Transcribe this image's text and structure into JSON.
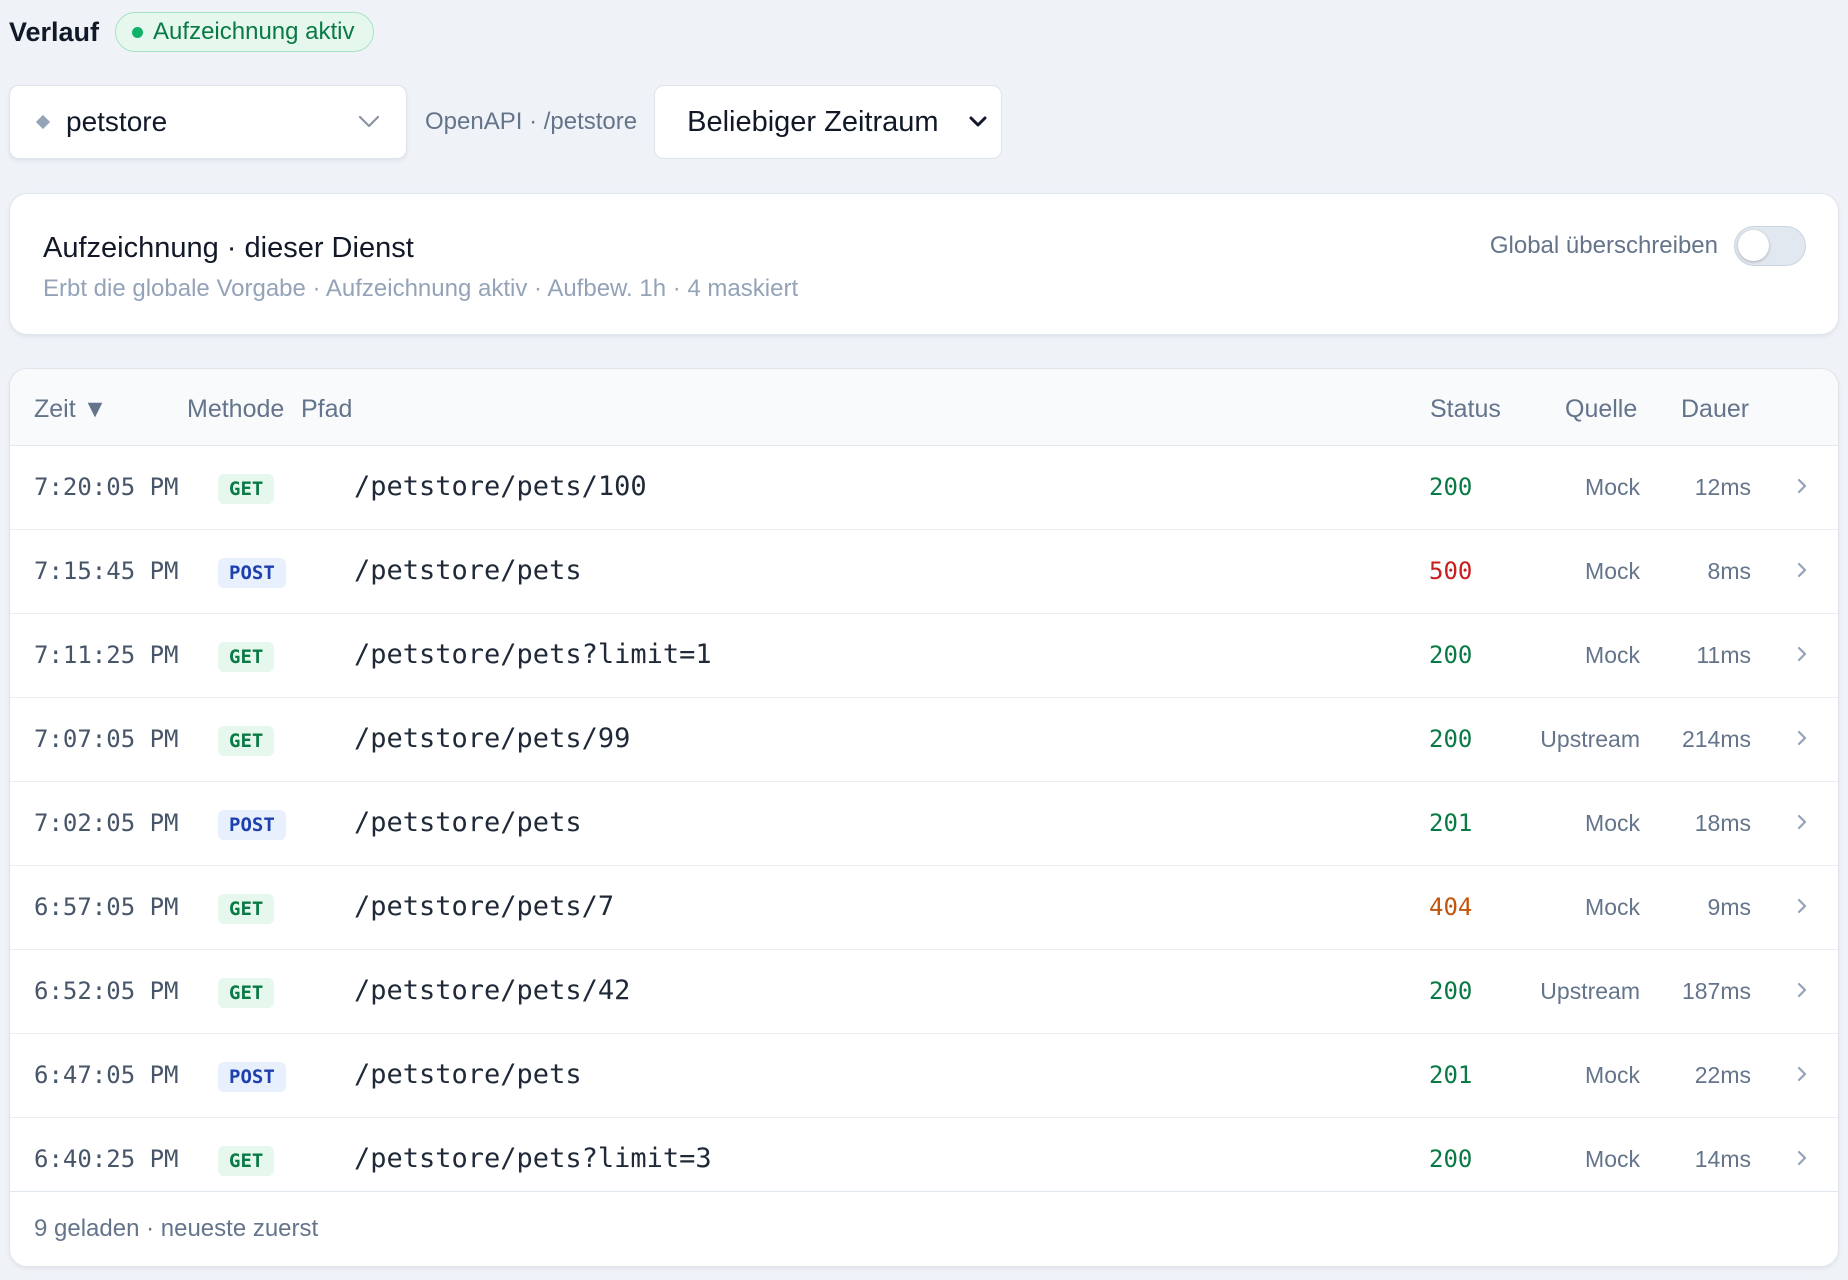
{
  "header": {
    "title": "Verlauf",
    "badge": "Aufzeichnung aktiv",
    "badge_color": "#10b26a"
  },
  "service_select": {
    "value": "petstore",
    "meta": "OpenAPI · /petstore"
  },
  "range_select": {
    "value": "Beliebiger Zeitraum"
  },
  "recording_card": {
    "title": "Aufzeichnung · dieser Dienst",
    "subtitle": "Erbt die globale Vorgabe · Aufzeichnung aktiv · Aufbew. 1h · 4 maskiert",
    "override_label": "Global überschreiben",
    "override_enabled": false
  },
  "table": {
    "headers": {
      "time": "Zeit ▼",
      "method": "Methode",
      "path": "Pfad",
      "status": "Status",
      "source": "Quelle",
      "duration": "Dauer"
    },
    "rows": [
      {
        "time": "7:20:05 PM",
        "method": "GET",
        "path": "/petstore/pets/100",
        "status": "200",
        "status_color": "#0a7a45",
        "source": "Mock",
        "duration": "12ms"
      },
      {
        "time": "7:15:45 PM",
        "method": "POST",
        "path": "/petstore/pets",
        "status": "500",
        "status_color": "#c81e1e",
        "source": "Mock",
        "duration": "8ms"
      },
      {
        "time": "7:11:25 PM",
        "method": "GET",
        "path": "/petstore/pets?limit=1",
        "status": "200",
        "status_color": "#0a7a45",
        "source": "Mock",
        "duration": "11ms"
      },
      {
        "time": "7:07:05 PM",
        "method": "GET",
        "path": "/petstore/pets/99",
        "status": "200",
        "status_color": "#0a7a45",
        "source": "Upstream",
        "duration": "214ms"
      },
      {
        "time": "7:02:05 PM",
        "method": "POST",
        "path": "/petstore/pets",
        "status": "201",
        "status_color": "#0a7a45",
        "source": "Mock",
        "duration": "18ms"
      },
      {
        "time": "6:57:05 PM",
        "method": "GET",
        "path": "/petstore/pets/7",
        "status": "404",
        "status_color": "#c2560c",
        "source": "Mock",
        "duration": "9ms"
      },
      {
        "time": "6:52:05 PM",
        "method": "GET",
        "path": "/petstore/pets/42",
        "status": "200",
        "status_color": "#0a7a45",
        "source": "Upstream",
        "duration": "187ms"
      },
      {
        "time": "6:47:05 PM",
        "method": "POST",
        "path": "/petstore/pets",
        "status": "201",
        "status_color": "#0a7a45",
        "source": "Mock",
        "duration": "22ms"
      },
      {
        "time": "6:40:25 PM",
        "method": "GET",
        "path": "/petstore/pets?limit=3",
        "status": "200",
        "status_color": "#0a7a45",
        "source": "Mock",
        "duration": "14ms"
      }
    ],
    "footer": "9 geladen · neueste zuerst"
  }
}
